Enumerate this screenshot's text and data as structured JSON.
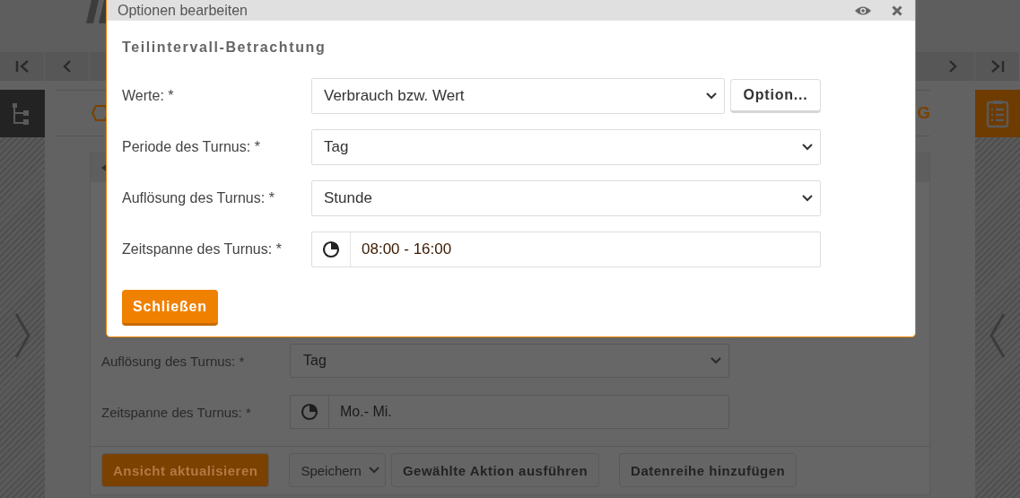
{
  "page": {
    "heading_fragment": "G",
    "fields": [
      {
        "kind": "select",
        "label": "Auflösung des Turnus: *",
        "value": "Tag"
      },
      {
        "kind": "time",
        "label": "Zeitspanne des Turnus: *",
        "value": "Mo.- Mi."
      }
    ],
    "buttons": [
      {
        "kind": "primary",
        "label": "Ansicht aktualisieren"
      },
      {
        "kind": "select",
        "label": "Speichern"
      },
      {
        "kind": "default",
        "label": "Gewählte Aktion ausführen"
      },
      {
        "kind": "default",
        "label": "Datenreihe hinzufügen"
      }
    ]
  },
  "dialog": {
    "title": "Optionen bearbeiten",
    "section_title": "Teilintervall-Betrachtung",
    "fields": [
      {
        "kind": "select",
        "label": "Werte: *",
        "value": "Verbrauch bzw. Wert",
        "button": "Option..."
      },
      {
        "kind": "select",
        "label": "Periode des Turnus: *",
        "value": "Tag"
      },
      {
        "kind": "select",
        "label": "Auflösung des Turnus: *",
        "value": "Stunde"
      },
      {
        "kind": "time",
        "label": "Zeitspanne des Turnus: *",
        "value": "08:00 - 16:00"
      }
    ],
    "close_button": "Schließen"
  }
}
